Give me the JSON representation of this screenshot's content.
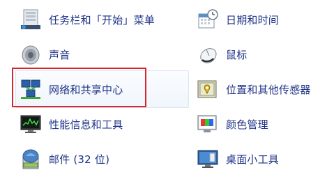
{
  "items": [
    {
      "label": "任务栏和「开始」菜单",
      "icon": "taskbar-start-menu-icon"
    },
    {
      "label": "日期和时间",
      "icon": "date-time-calendar-icon"
    },
    {
      "label": "声音",
      "icon": "speaker-sound-icon"
    },
    {
      "label": "鼠标",
      "icon": "mouse-icon"
    },
    {
      "label": "网络和共享中心",
      "icon": "network-sharing-center-icon"
    },
    {
      "label": "位置和其他传感器",
      "icon": "location-sensors-icon"
    },
    {
      "label": "性能信息和工具",
      "icon": "performance-monitor-icon"
    },
    {
      "label": "颜色管理",
      "icon": "color-management-icon"
    },
    {
      "label": "邮件 (32 位)",
      "icon": "mail-icon"
    },
    {
      "label": "桌面小工具",
      "icon": "desktop-gadgets-icon"
    }
  ],
  "highlight": {
    "color": "#d6262e"
  },
  "colors": {
    "link": "#1e3287",
    "background": "#ffffff"
  }
}
